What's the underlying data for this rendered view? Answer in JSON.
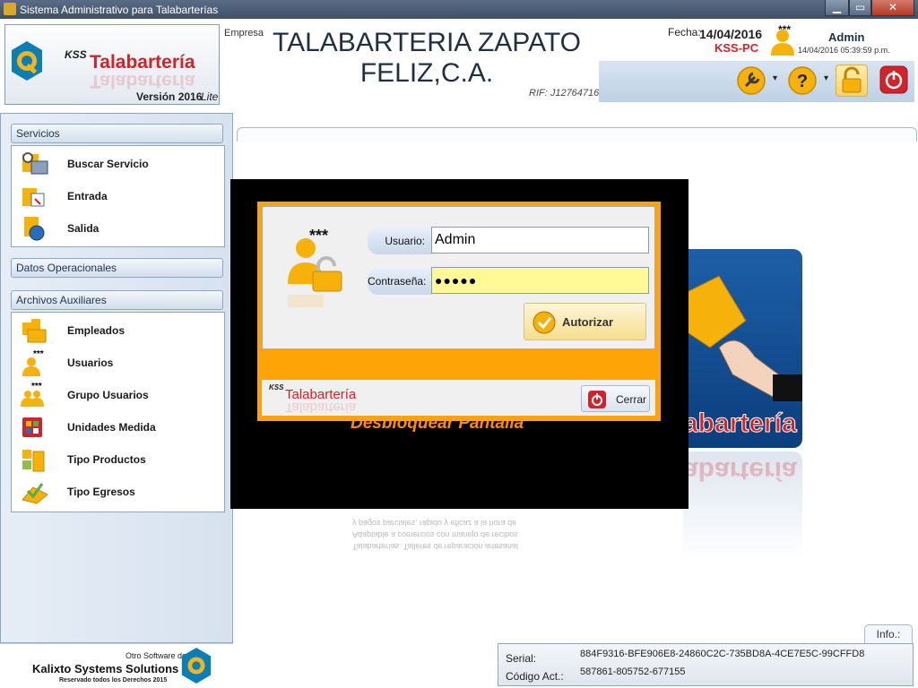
{
  "window": {
    "title": "Sistema Administrativo para Talabarterías",
    "minimize": "▁",
    "maximize": "▭",
    "close": "✕"
  },
  "brand": {
    "kss": "KSS",
    "name": "Talabartería",
    "version_label": "Versión 2016",
    "version_edition": "Lite"
  },
  "company": {
    "label": "Empresa",
    "name_line1": "TALABARTERIA ZAPATO",
    "name_line2": "FELIZ,C.A.",
    "rif": "RIF: J12764716"
  },
  "session": {
    "date_label": "Fecha:",
    "date": "14/04/2016",
    "machine": "KSS-PC",
    "stars": "***",
    "user": "Admin",
    "timestamp": "14/04/2016  05:39:59 p.m."
  },
  "toolbar": {
    "tools_icon": "wrench-icon",
    "help_icon": "help-icon",
    "lock_icon": "lock-icon",
    "power_icon": "power-icon",
    "dropdown": "▾"
  },
  "sidebar": {
    "groups": [
      {
        "label": "Servicios"
      },
      {
        "label": "Datos Operacionales"
      },
      {
        "label": "Archivos Auxiliares"
      }
    ],
    "servicios": [
      {
        "label": "Buscar Servicio"
      },
      {
        "label": "Entrada"
      },
      {
        "label": "Salida"
      }
    ],
    "auxiliares": [
      {
        "label": "Empleados"
      },
      {
        "label": "Usuarios"
      },
      {
        "label": "Grupo Usuarios"
      },
      {
        "label": "Unidades Medida"
      },
      {
        "label": "Tipo Productos"
      },
      {
        "label": "Tipo Egresos"
      }
    ]
  },
  "footer": {
    "other_software": "Otro Software de",
    "company": "Kalixto Systems Solutions",
    "rights": "Reservado todos los Derechos 2015"
  },
  "info": {
    "tab": "Info.:",
    "serial_label": "Serial:",
    "serial": "884F9316-BFE906E8-24860C2C-735BD8A-4CE7E5C-99CFFD8",
    "code_label": "Código Act.:",
    "code": "587861-805752-677155"
  },
  "background": {
    "banner_text": "Desbloquear Pantalla",
    "banner_brand": "abartería",
    "reflected_lines": [
      "Talabarterías. Talleres de reparación artesanal",
      "Adaptable a comercios con manejo de recibos",
      "y pagos parciales, rápido y eficaz a la hora de"
    ]
  },
  "dialog": {
    "stars": "***",
    "user_label": "Usuario:",
    "user_value": "Admin",
    "pass_label": "Contraseña:",
    "pass_value": "●●●●●",
    "authorize": "Autorizar",
    "close": "Cerrar",
    "kss": "KSS",
    "brand": "Talabartería"
  },
  "colors": {
    "accent_red": "#d2232a",
    "dialog_orange": "#ffa406",
    "titlebar": "#4a5b74"
  }
}
